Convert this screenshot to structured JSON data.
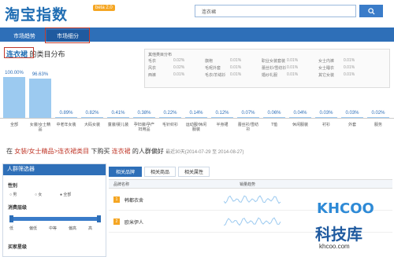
{
  "header": {
    "logo": "淘宝指数",
    "beta": "beta 2.0",
    "search_value": "连衣裙"
  },
  "tabs": [
    {
      "label": "市场趋势"
    },
    {
      "label": "市场细分"
    }
  ],
  "category": {
    "keyword": "连衣裙",
    "title_suffix": "的类目分布",
    "other_title": "其他类目分布",
    "others": [
      [
        "毛衣",
        "0.02%",
        "旗袍",
        "0.01%",
        "职业女装套装",
        "0.01%",
        "女士内裤",
        "0.01%"
      ],
      [
        "风衣",
        "0.02%",
        "毛呢外套",
        "0.01%",
        "蕾丝衫/雪纺衫",
        "0.01%",
        "女士睡衣",
        "0.01%"
      ],
      [
        "西裤",
        "0.01%",
        "毛衣/羊绒衫",
        "0.01%",
        "婚纱礼服",
        "0.01%",
        "其它女装",
        "0.01%"
      ]
    ]
  },
  "chart_data": {
    "type": "bar",
    "categories": [
      "全部",
      "女装/女士精品",
      "中老年女装",
      "大码女装",
      "童装/婴儿装",
      "孕妇装/孕产妇用品",
      "毛针织衫",
      "运动服/休闲服装",
      "半身裙",
      "蕾丝衫/雪纺衫",
      "T恤",
      "休闲服装",
      "衬衫",
      "外套",
      "服务"
    ],
    "values": [
      100.0,
      96.63,
      0.89,
      0.82,
      0.41,
      0.38,
      0.22,
      0.14,
      0.12,
      0.07,
      0.06,
      0.04,
      0.03,
      0.03,
      0.02
    ],
    "labels": [
      "100.00%",
      "96.63%",
      "0.89%",
      "0.82%",
      "0.41%",
      "0.38%",
      "0.22%",
      "0.14%",
      "0.12%",
      "0.07%",
      "0.06%",
      "0.04%",
      "0.03%",
      "0.03%",
      "0.02%"
    ],
    "ylim": [
      0,
      100
    ]
  },
  "section2": {
    "prefix": "在",
    "path": "女装/女士精品>连衣裙类目",
    "mid": "下购买",
    "keyword": "连衣裙",
    "suffix": "的人群偏好",
    "date": "最近30天(2014-07-29 至 2014-08-27)"
  },
  "filter": {
    "title": "人群筛选器",
    "gender_label": "性别",
    "gender_opts": [
      "男",
      "女",
      "全部"
    ],
    "age_label": "消费层级",
    "age_opts": [
      "低",
      "偏低",
      "中等",
      "偏高",
      "高"
    ],
    "more_label": "买家星级"
  },
  "right": {
    "tabs": [
      "相关品牌",
      "相关商品",
      "相关属性"
    ],
    "col_brand": "品牌名称",
    "col_trend": "销量趋势",
    "rows": [
      {
        "rank": "1",
        "name": "韩都衣舍"
      },
      {
        "rank": "2",
        "name": "欧米伊人"
      }
    ]
  },
  "watermark": {
    "brand": "KHCOO",
    "cn": "科技库",
    "url": "khcoo.com"
  },
  "colors": {
    "primary": "#2e6fb8",
    "bar": "#9ccaf0",
    "highlight": "#c0392b"
  }
}
